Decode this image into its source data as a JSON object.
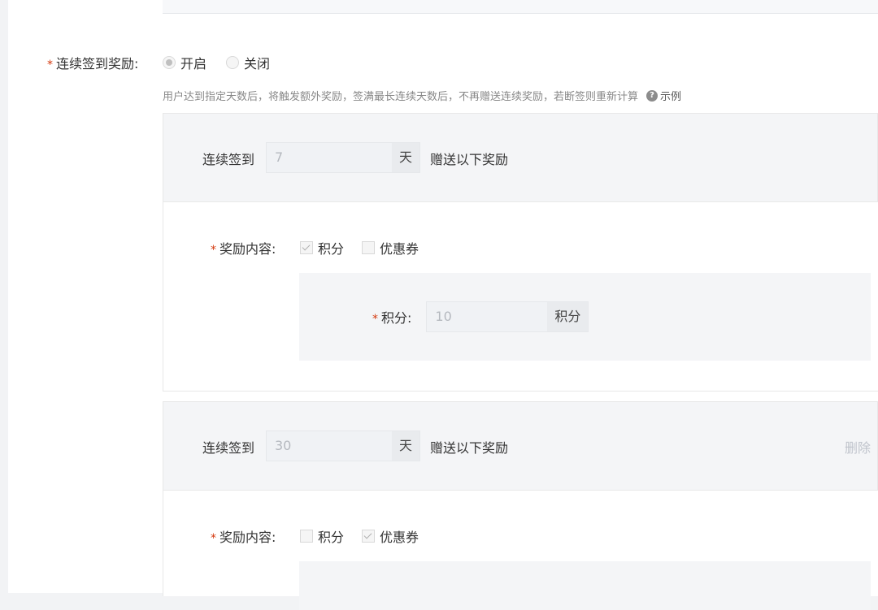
{
  "form": {
    "continuous_label": "连续签到奖励:",
    "radio_on": "开启",
    "radio_off": "关闭",
    "hint": "用户达到指定天数后，将触发额外奖励，签满最长连续天数后，不再赠送连续奖励，若断签则重新计算",
    "example": "示例"
  },
  "rules": [
    {
      "prefix": "连续签到",
      "days": "7",
      "unit": "天",
      "suffix": "赠送以下奖励",
      "reward_label": "奖励内容:",
      "opt_points": "积分",
      "opt_coupon": "优惠券",
      "points_label": "积分:",
      "points_value": "10",
      "points_unit": "积分"
    },
    {
      "prefix": "连续签到",
      "days": "30",
      "unit": "天",
      "suffix": "赠送以下奖励",
      "delete": "删除",
      "reward_label": "奖励内容:",
      "opt_points": "积分",
      "opt_coupon": "优惠券"
    }
  ]
}
